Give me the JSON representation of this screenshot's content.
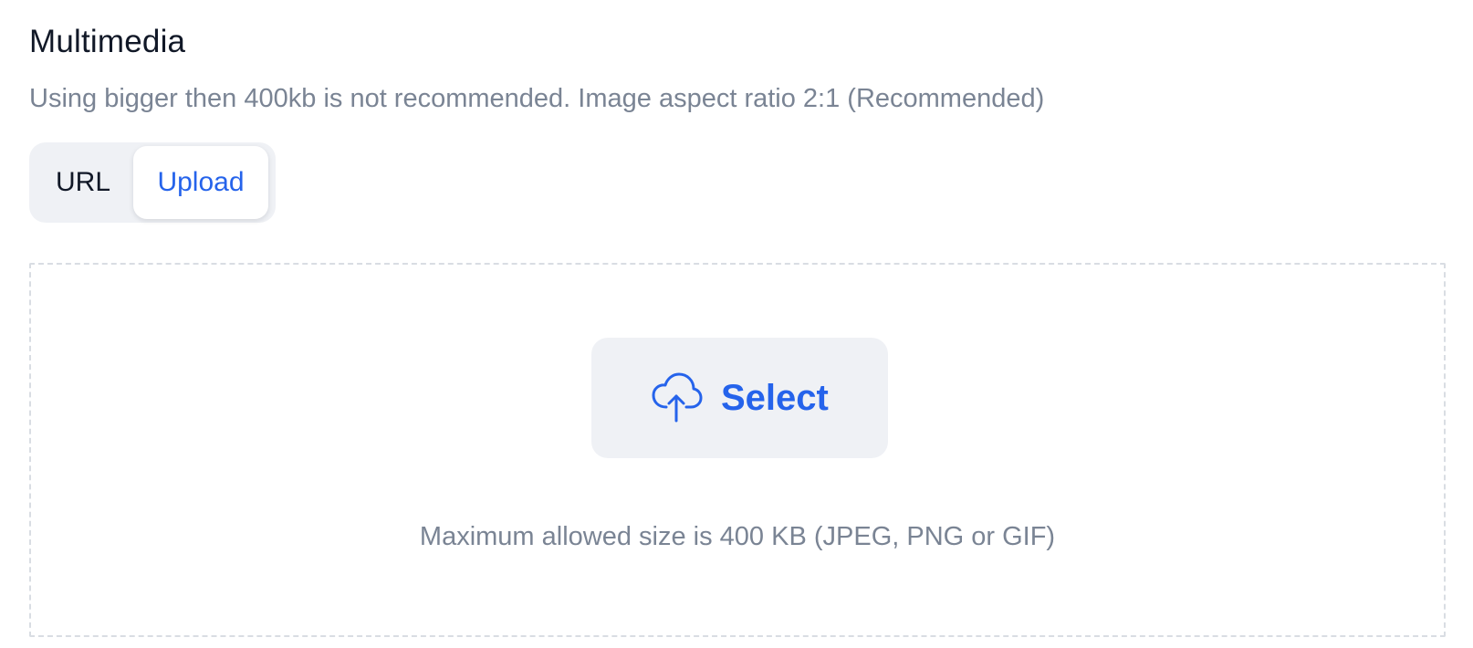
{
  "section": {
    "title": "Multimedia",
    "subtitle": "Using bigger then 400kb is not recommended. Image aspect ratio 2:1 (Recommended)"
  },
  "source_toggle": {
    "options": [
      {
        "label": "URL",
        "selected": false
      },
      {
        "label": "Upload",
        "selected": true
      }
    ]
  },
  "upload": {
    "select_label": "Select",
    "select_icon": "cloud-upload-icon",
    "hint": "Maximum allowed size is 400 KB (JPEG, PNG or GIF)"
  },
  "colors": {
    "accent": "#2563eb",
    "muted_text": "#7a8494",
    "surface": "#eff1f5",
    "dashed_border": "#d9dde3"
  }
}
